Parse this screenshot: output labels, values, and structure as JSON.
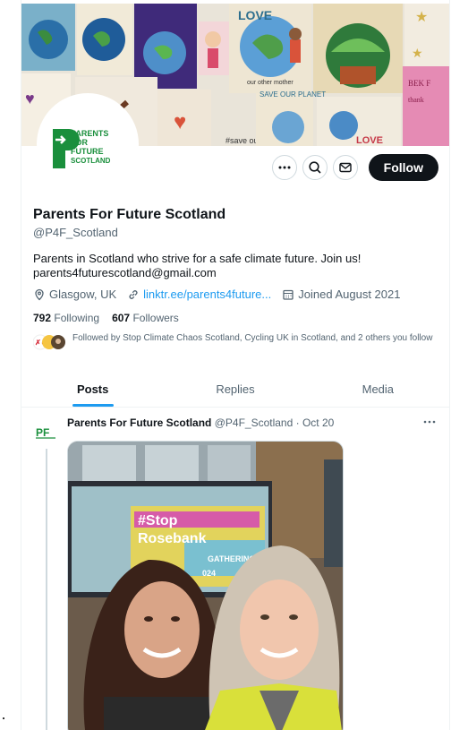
{
  "profile": {
    "name": "Parents For Future Scotland",
    "handle": "@P4F_Scotland",
    "bio": "Parents in Scotland who strive for a safe climate future. Join us!",
    "email": "parents4futurescotland@gmail.com",
    "location": "Glasgow, UK",
    "link": "linktr.ee/parents4future...",
    "joined": "Joined August 2021",
    "following_count": "792",
    "following_label": "Following",
    "followers_count": "607",
    "followers_label": "Followers",
    "followed_by": "Followed by Stop Climate Chaos Scotland, Cycling UK in Scotland, and 2 others you follow"
  },
  "avatar_logo": {
    "lines": [
      "PARENTS",
      "FOR",
      "FUTURE",
      "SCOTLAND"
    ],
    "mark": "P"
  },
  "banner_text": {
    "love_top": "LOVE",
    "save_our_planet": "SAVE OUR PLANET",
    "save_world": "#save our world",
    "love_bottom": "LOVE",
    "our_other_mother": "our other mother"
  },
  "actions": {
    "follow_label": "Follow"
  },
  "tabs": [
    {
      "label": "Posts",
      "active": true
    },
    {
      "label": "Replies",
      "active": false
    },
    {
      "label": "Media",
      "active": false
    }
  ],
  "post": {
    "author": "Parents For Future Scotland",
    "handle": "@P4F_Scotland",
    "separator": "·",
    "date": "Oct 20",
    "avatar_text": "PF",
    "image_text": {
      "line1": "#Stop",
      "line2": "Rosebank",
      "line3": "GATHERING",
      "line4": "024"
    }
  },
  "colors": {
    "accent": "#1d9bf0",
    "logo_green": "#1a8f3c",
    "text_primary": "#0f1419",
    "text_secondary": "#536471",
    "follow_button": "#0f1419"
  },
  "icons": [
    "more-icon",
    "search-icon",
    "mail-icon",
    "location-icon",
    "link-icon",
    "calendar-icon"
  ]
}
